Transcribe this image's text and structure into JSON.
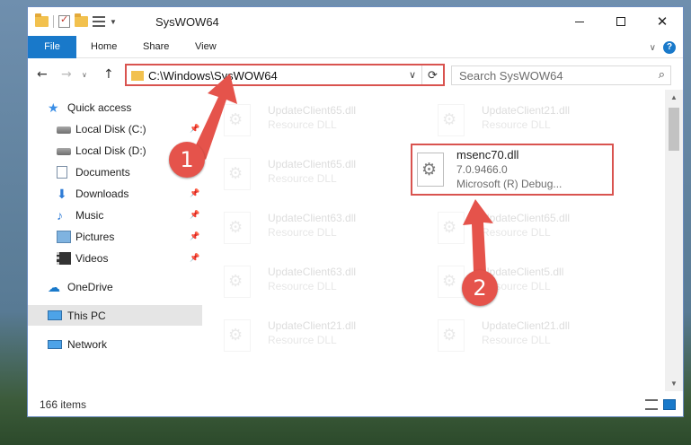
{
  "window": {
    "title": "SysWOW64",
    "controls": {
      "minimize": "minimize",
      "maximize": "maximize",
      "close": "✕"
    }
  },
  "ribbon": {
    "tabs": [
      "File",
      "Home",
      "Share",
      "View"
    ],
    "help": "?"
  },
  "address": {
    "path": "C:\\Windows\\SysWOW64",
    "search_placeholder": "Search SysWOW64"
  },
  "sidebar": {
    "items": [
      {
        "label": "Quick access",
        "icon": "star-icon",
        "pinned": false
      },
      {
        "label": "Local Disk (C:)",
        "icon": "disk-icon",
        "pinned": true
      },
      {
        "label": "Local Disk (D:)",
        "icon": "disk-icon",
        "pinned": false
      },
      {
        "label": "Documents",
        "icon": "documents-icon",
        "pinned": true
      },
      {
        "label": "Downloads",
        "icon": "download-icon",
        "pinned": true
      },
      {
        "label": "Music",
        "icon": "music-icon",
        "pinned": true
      },
      {
        "label": "Pictures",
        "icon": "pictures-icon",
        "pinned": true
      },
      {
        "label": "Videos",
        "icon": "videos-icon",
        "pinned": true
      },
      {
        "label": "OneDrive",
        "icon": "cloud-icon",
        "pinned": false
      },
      {
        "label": "This PC",
        "icon": "computer-icon",
        "pinned": false,
        "selected": true
      },
      {
        "label": "Network",
        "icon": "network-icon",
        "pinned": false
      }
    ]
  },
  "files": {
    "left": [
      {
        "name": "UpdateClient65.dll",
        "type": "Resource DLL"
      },
      {
        "name": "UpdateClient65.dll",
        "type": "Resource DLL"
      },
      {
        "name": "UpdateClient63.dll",
        "type": "Resource DLL"
      },
      {
        "name": "UpdateClient63.dll",
        "type": "Resource DLL"
      },
      {
        "name": "UpdateClient21.dll",
        "type": "Resource DLL"
      }
    ],
    "right": [
      {
        "name": "UpdateClient21.dll",
        "type": "Resource DLL"
      },
      {
        "name": "UpdateClient65.dll",
        "type": "Resource DLL"
      },
      {
        "name": "UpdateClient5.dll",
        "type": "Resource DLL"
      },
      {
        "name": "UpdateClient21.dll",
        "type": "Resource DLL"
      }
    ],
    "highlighted": {
      "name": "msenc70.dll",
      "version": "7.0.9466.0",
      "description": "Microsoft (R) Debug..."
    }
  },
  "status": {
    "count": "166 items"
  },
  "annotations": {
    "step1": "1",
    "step2": "2",
    "color": "#e5534b"
  }
}
